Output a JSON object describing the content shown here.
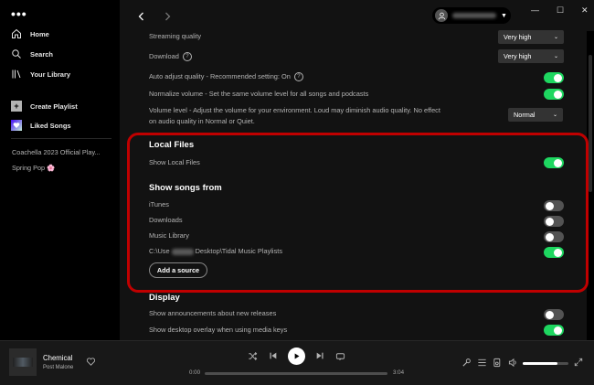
{
  "sidebar": {
    "menu_glyph": "•••",
    "nav": [
      {
        "label": "Home",
        "icon": "home-icon"
      },
      {
        "label": "Search",
        "icon": "search-icon"
      },
      {
        "label": "Your Library",
        "icon": "library-icon"
      }
    ],
    "actions": [
      {
        "label": "Create Playlist",
        "icon": "plus-icon"
      },
      {
        "label": "Liked Songs",
        "icon": "heart-icon"
      }
    ],
    "playlists": [
      "Coachella 2023 Official Play...",
      "Spring Pop 🌸"
    ]
  },
  "settings": {
    "streaming_quality": {
      "label": "Streaming quality",
      "value": "Very high"
    },
    "download": {
      "label": "Download",
      "value": "Very high"
    },
    "auto_adjust": {
      "label": "Auto adjust quality - Recommended setting: On",
      "on": true
    },
    "normalize": {
      "label": "Normalize volume - Set the same volume level for all songs and podcasts",
      "on": true
    },
    "volume_level": {
      "label": "Volume level - Adjust the volume for your environment. Loud may diminish audio quality. No effect on audio quality in Normal or Quiet.",
      "value": "Normal"
    },
    "local_files": {
      "title": "Local Files",
      "show_label": "Show Local Files",
      "show_on": true,
      "songs_from_title": "Show songs from",
      "sources": [
        {
          "label": "iTunes",
          "on": false
        },
        {
          "label": "Downloads",
          "on": false
        },
        {
          "label": "Music Library",
          "on": false
        },
        {
          "label_prefix": "C:\\Use",
          "label_suffix": "Desktop\\Tidal Music Playlists",
          "on": true
        }
      ],
      "add_source": "Add a source"
    },
    "display": {
      "title": "Display",
      "items": [
        {
          "label": "Show announcements about new releases",
          "on": false
        },
        {
          "label": "Show desktop overlay when using media keys",
          "on": true
        }
      ]
    }
  },
  "player": {
    "track": "Chemical",
    "artist": "Post Malone",
    "elapsed": "0:00",
    "duration": "3:04",
    "progress": 0,
    "volume": 0.75
  },
  "window": {
    "minimize": "—",
    "maximize": "☐",
    "close": "✕"
  },
  "colors": {
    "accent": "#1ed760",
    "highlight_border": "#c00000"
  }
}
